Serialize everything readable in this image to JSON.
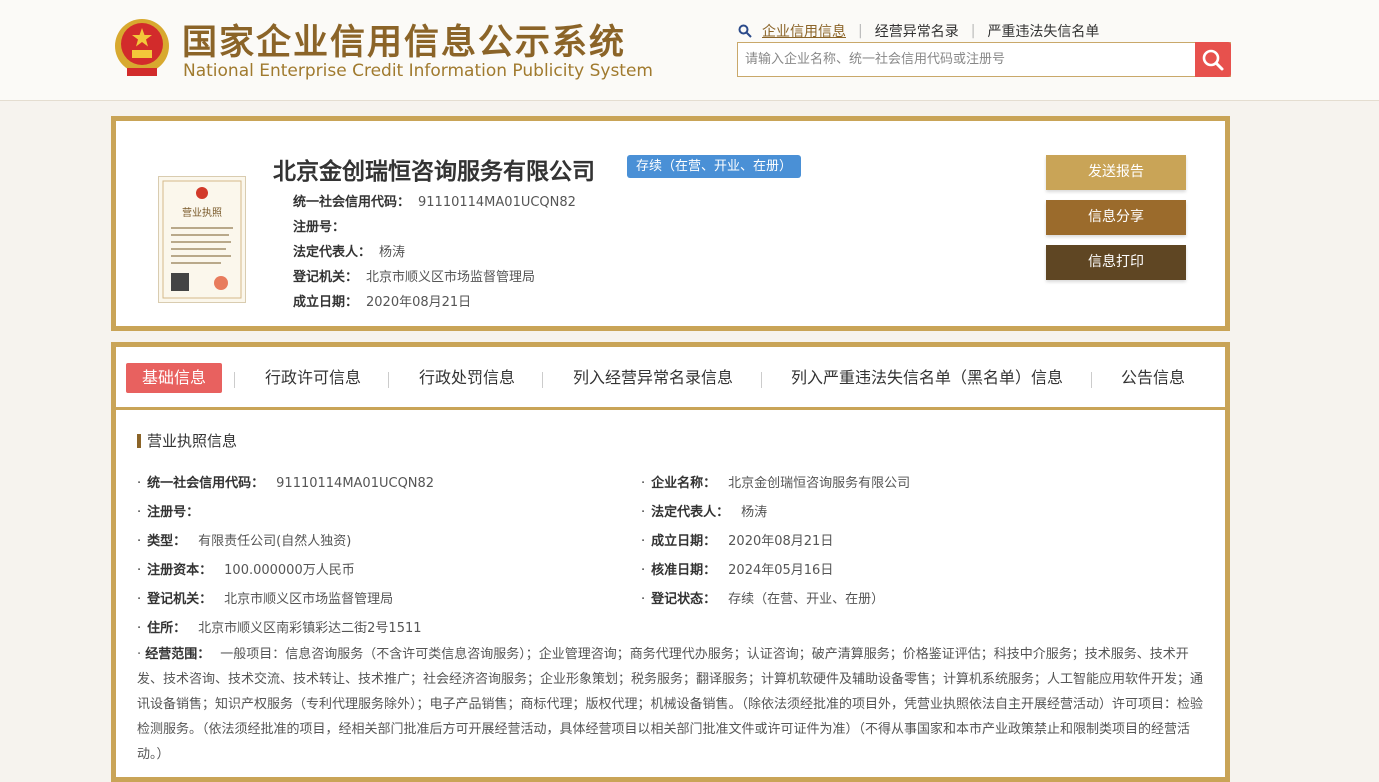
{
  "header": {
    "title_cn": "国家企业信用信息公示系统",
    "title_en": "National Enterprise Credit Information Publicity System",
    "links": [
      "企业信用信息",
      "经营异常名录",
      "严重违法失信名单"
    ],
    "search_placeholder": "请输入企业名称、统一社会信用代码或注册号"
  },
  "company": {
    "name": "北京金创瑞恒咨询服务有限公司",
    "status": "存续（在营、开业、在册）",
    "license_caption": "营业执照",
    "rows": [
      {
        "label": "统一社会信用代码：",
        "value": "91110114MA01UCQN82"
      },
      {
        "label": "注册号：",
        "value": ""
      },
      {
        "label": "法定代表人：",
        "value": "杨涛"
      },
      {
        "label": "登记机关：",
        "value": "北京市顺义区市场监督管理局"
      },
      {
        "label": "成立日期：",
        "value": "2020年08月21日"
      }
    ],
    "actions": [
      "发送报告",
      "信息分享",
      "信息打印"
    ]
  },
  "tabs": [
    "基础信息",
    "行政许可信息",
    "行政处罚信息",
    "列入经营异常名录信息",
    "列入严重违法失信名单（黑名单）信息",
    "公告信息"
  ],
  "license_info": {
    "section_title": "营业执照信息",
    "left": [
      {
        "label": "统一社会信用代码：",
        "value": "91110114MA01UCQN82"
      },
      {
        "label": "注册号：",
        "value": ""
      },
      {
        "label": "类型：",
        "value": "有限责任公司(自然人独资)"
      },
      {
        "label": "注册资本：",
        "value": "100.000000万人民币"
      },
      {
        "label": "登记机关：",
        "value": "北京市顺义区市场监督管理局"
      },
      {
        "label": "住所：",
        "value": "北京市顺义区南彩镇彩达二街2号1511"
      }
    ],
    "right": [
      {
        "label": "企业名称：",
        "value": "北京金创瑞恒咨询服务有限公司"
      },
      {
        "label": "法定代表人：",
        "value": "杨涛"
      },
      {
        "label": "成立日期：",
        "value": "2020年08月21日"
      },
      {
        "label": "核准日期：",
        "value": "2024年05月16日"
      },
      {
        "label": "登记状态：",
        "value": "存续（在营、开业、在册）"
      }
    ],
    "scope_label": "经营范围：",
    "scope_value": "一般项目：信息咨询服务（不含许可类信息咨询服务）；企业管理咨询；商务代理代办服务；认证咨询；破产清算服务；价格鉴证评估；科技中介服务；技术服务、技术开发、技术咨询、技术交流、技术转让、技术推广；社会经济咨询服务；企业形象策划；税务服务；翻译服务；计算机软硬件及辅助设备零售；计算机系统服务；人工智能应用软件开发；通讯设备销售；知识产权服务（专利代理服务除外）；电子产品销售；商标代理；版权代理；机械设备销售。（除依法须经批准的项目外，凭营业执照依法自主开展经营活动）许可项目：检验检测服务。（依法须经批准的项目，经相关部门批准后方可开展经营活动，具体经营项目以相关部门批准文件或许可证件为准）（不得从事国家和本市产业政策禁止和限制类项目的经营活动。）"
  },
  "colors": {
    "gold": "#c9a457",
    "brown": "#8b6428",
    "tab_active": "#e8615f",
    "status_blue": "#4a90d6",
    "search_red": "#e7514d",
    "btn1": "#c9a457",
    "btn2": "#9b6b2c",
    "btn3": "#5f4623"
  }
}
